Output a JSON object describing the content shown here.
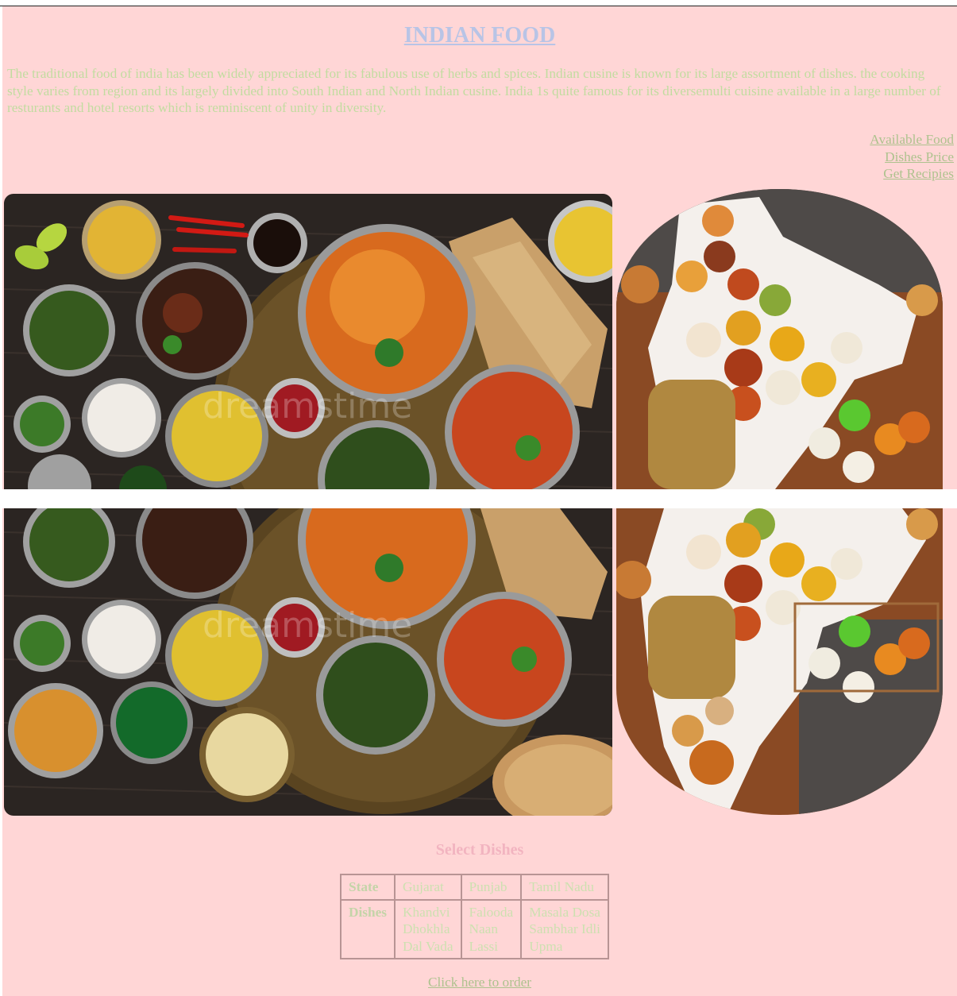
{
  "header": {
    "title": "INDIAN FOOD",
    "intro": "The traditional food of india has been widely appreciated for its fabulous use of herbs and spices. Indian cusine is known for its large assortment of dishes. the cooking style varies from region and its largely divided into South Indian and North Indian cusine. India 1s quite famous for its diversemulti cuisine available in a large number of resturants and hotel resorts which is reminiscent of unity in diversity."
  },
  "nav": {
    "links": [
      "Available Food",
      "Dishes Price",
      "Get Recipies"
    ]
  },
  "images": {
    "spread_watermark": "dreamstime"
  },
  "dishes": {
    "heading": "Select Dishes",
    "row_labels": [
      "State",
      "Dishes"
    ],
    "states": [
      "Gujarat",
      "Punjab",
      "Tamil Nadu"
    ],
    "dish_lists": [
      [
        "Khandvi",
        "Dhokhla",
        "Dal Vada"
      ],
      [
        "Falooda",
        "Naan",
        "Lassi"
      ],
      [
        "Masala Dosa",
        "Sambhar Idli",
        "Upma"
      ]
    ]
  },
  "footer": {
    "order_link": "Click here to order"
  },
  "colors": {
    "page_background": "#ffd6d6",
    "title": "#b8c4e6",
    "body_text": "#c2dca0",
    "link": "#aec28e",
    "dishes_heading": "#f2b4c0",
    "table_border": "#b89494"
  }
}
